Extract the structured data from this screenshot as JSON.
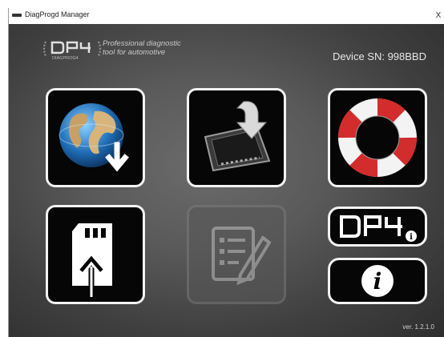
{
  "window": {
    "title": "DiagProgd Manager",
    "close_label": "X"
  },
  "header": {
    "logo_text": "DP4",
    "logo_subtext": "DIAGPROG4",
    "tagline_line1": "Professional diagnostic",
    "tagline_line2": "tool for automotive",
    "serial": "Device SN: 998BBD"
  },
  "tiles": [
    {
      "name": "download-update-tile",
      "icon": "globe-download-icon",
      "enabled": true
    },
    {
      "name": "install-to-device-tile",
      "icon": "tablet-install-icon",
      "enabled": true
    },
    {
      "name": "support-tile",
      "icon": "lifebuoy-icon",
      "enabled": true
    },
    {
      "name": "sd-card-upload-tile",
      "icon": "sd-card-upload-icon",
      "enabled": true
    },
    {
      "name": "edit-report-tile",
      "icon": "document-edit-icon",
      "enabled": false
    },
    {
      "name": "device-info-tile",
      "icon": "dp4-info-icon",
      "enabled": true
    },
    {
      "name": "about-tile",
      "icon": "info-icon",
      "enabled": true
    }
  ],
  "dp4_badge_text": "DP4",
  "info_glyph": "i",
  "footer": {
    "version": "ver. 1.2.1.0"
  },
  "colors": {
    "tile_border": "#f2f2f2",
    "tile_fill": "#060606",
    "background_center": "#6b6b6b",
    "background_edge": "#2e2e2e",
    "lifebuoy_red": "#d22c2c"
  }
}
